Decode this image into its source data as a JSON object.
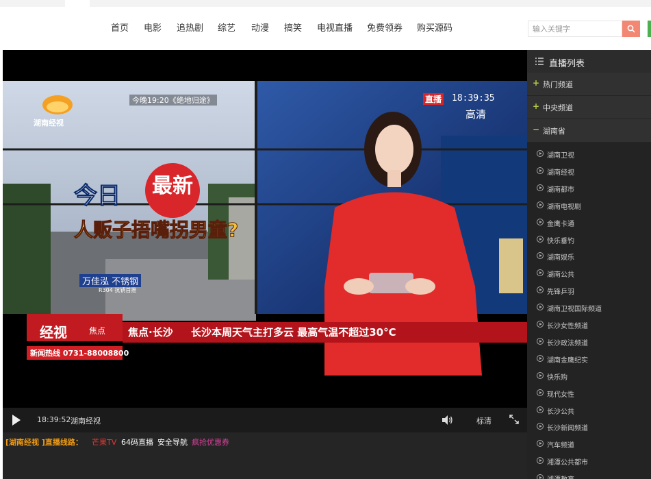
{
  "nav": {
    "items": [
      "首页",
      "电影",
      "追热剧",
      "综艺",
      "动漫",
      "搞笑",
      "电视直播",
      "免费领券",
      "购买源码"
    ]
  },
  "search": {
    "placeholder": "输入关键字"
  },
  "video": {
    "logo": "湖南经视",
    "promo": "今晚19:20《绝地归途》",
    "live_badge": "直播",
    "clock": "18:39:35",
    "hd": "高清",
    "today": "今日",
    "new": "最新",
    "headline": "人贩子捂嘴拐男童?",
    "ad": "万佳泓 不锈钢",
    "ad_sub": "R304 抗锈首推",
    "brand": "经视",
    "brand_tag": "焦点",
    "hotline": "新闻热线 0731-88008800",
    "segment": "焦点·长沙",
    "ticker": "长沙本周天气主打多云  最高气温不超过30°C"
  },
  "controls": {
    "time": "18:39:52",
    "channel": "湖南经视",
    "quality": "标清"
  },
  "lines": {
    "prefix": "[湖南经视 ]直播线路：",
    "items": [
      "芒果TV",
      "64码直播",
      "安全导航",
      "疯抢优惠券"
    ],
    "colors": [
      "#e53935",
      "#ffffff",
      "#ffffff",
      "#e040a0"
    ]
  },
  "sidebar": {
    "title": "直播列表",
    "categories": [
      {
        "symbol": "+",
        "label": "热门频道"
      },
      {
        "symbol": "+",
        "label": "中央频道"
      },
      {
        "symbol": "−",
        "label": "湖南省"
      }
    ],
    "channels": [
      "湖南卫视",
      "湖南经视",
      "湖南都市",
      "湖南电视剧",
      "金鹰卡通",
      "快乐垂钓",
      "湖南娱乐",
      "湖南公共",
      "先锋乒羽",
      "湖南卫视国际频道",
      "长沙女性频道",
      "长沙政法频道",
      "湖南金鹰纪实",
      "快乐购",
      "现代女性",
      "长沙公共",
      "长沙新闻频道",
      "汽车频道",
      "湘潭公共都市",
      "湘潭教育"
    ]
  },
  "colors": {
    "accent": "#f28773",
    "ticker_bar": "#b3141b",
    "player_bg": "#000000"
  }
}
